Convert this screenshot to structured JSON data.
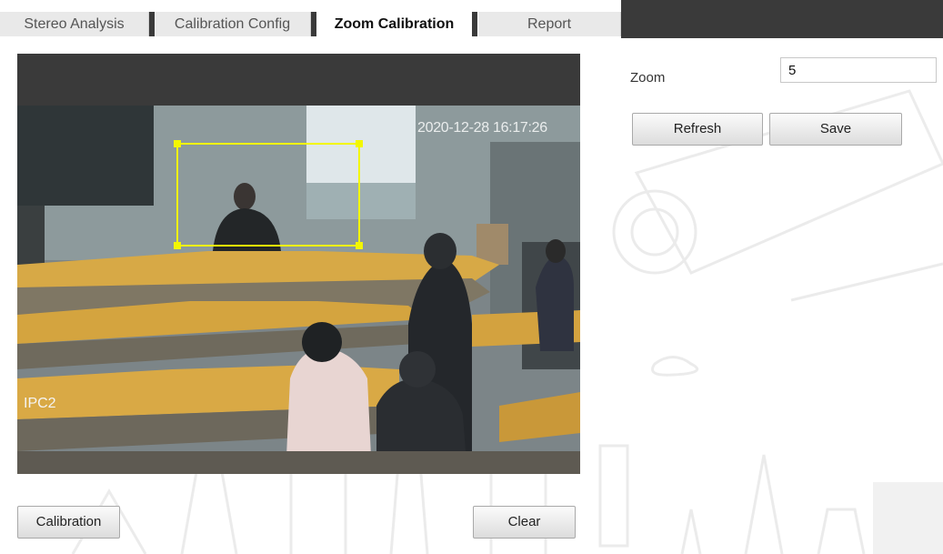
{
  "tabs": [
    {
      "label": "Stereo Analysis",
      "active": false
    },
    {
      "label": "Calibration Config",
      "active": false
    },
    {
      "label": "Zoom Calibration",
      "active": true
    },
    {
      "label": "Report",
      "active": false
    }
  ],
  "video": {
    "timestamp": "2020-12-28 16:17:26",
    "channel_label": "IPC2"
  },
  "zoom": {
    "label": "Zoom",
    "value": "5"
  },
  "buttons": {
    "refresh": "Refresh",
    "save": "Save",
    "calibration": "Calibration",
    "clear": "Clear"
  },
  "colors": {
    "tab_bar_dark": "#3a3a3a",
    "calibration_box": "#f3f700"
  }
}
